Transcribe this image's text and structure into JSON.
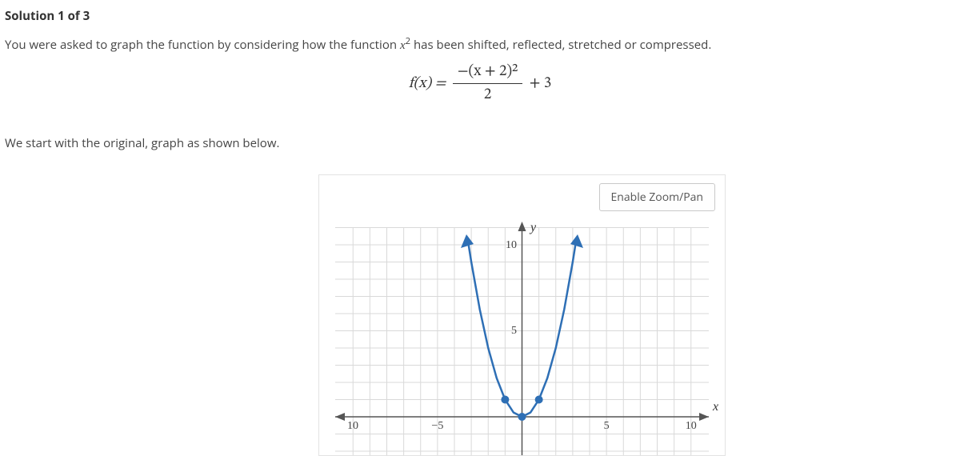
{
  "heading": "Solution 1 of 3",
  "intro": {
    "before_sup": "You were asked to graph the function by considering how the function ",
    "base": "x",
    "sup": "2",
    "after_sup": " has been shifted, reflected, stretched or compressed."
  },
  "formula": {
    "lhs": "f(x) = ",
    "num": "−(x + 2)²",
    "den": "2",
    "rhs": " + 3"
  },
  "subtext": "We start with the original, graph as shown below.",
  "graph": {
    "zoom_button": "Enable Zoom/Pan",
    "axis_y": "y",
    "axis_x": "x",
    "ticks": {
      "x_neg10": "10",
      "x_neg5": "−5",
      "x_5": "5",
      "x_10": "10",
      "y_5": "5",
      "y_10": "10"
    }
  },
  "chart_data": {
    "type": "line",
    "title": "",
    "xlabel": "x",
    "ylabel": "y",
    "xlim": [
      -10,
      10
    ],
    "ylim": [
      -2,
      10
    ],
    "series": [
      {
        "name": "x^2",
        "x": [
          -3.2,
          -3,
          -2.5,
          -2,
          -1.5,
          -1,
          -0.5,
          0,
          0.5,
          1,
          1.5,
          2,
          2.5,
          3,
          3.2
        ],
        "y": [
          10.24,
          9,
          6.25,
          4,
          2.25,
          1,
          0.25,
          0,
          0.25,
          1,
          2.25,
          4,
          6.25,
          9,
          10.24
        ]
      }
    ],
    "marked_points": [
      {
        "x": -1,
        "y": 1
      },
      {
        "x": 0,
        "y": 0
      },
      {
        "x": 1,
        "y": 1
      }
    ]
  }
}
